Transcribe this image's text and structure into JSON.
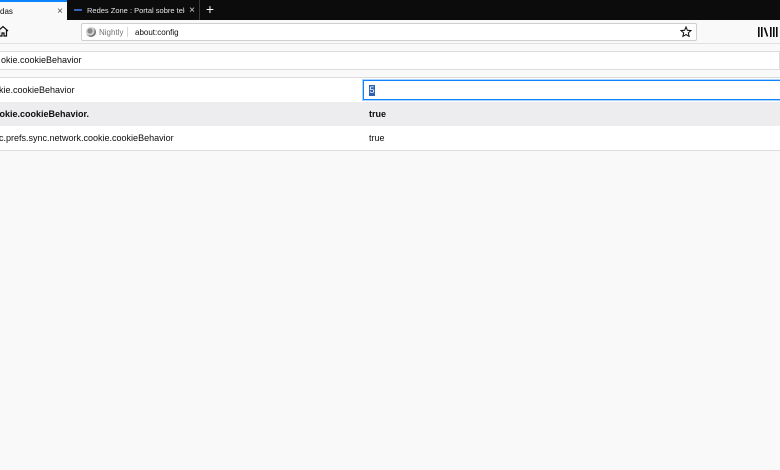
{
  "tabs": [
    {
      "title": "das",
      "active": true,
      "close": "×"
    },
    {
      "title": "Redes Zone : Portal sobre telec",
      "active": false,
      "close": "×"
    }
  ],
  "new_tab_label": "+",
  "navbar": {
    "identity_label": "Nightly",
    "url": "about:config"
  },
  "search": {
    "value": "okie.cookieBehavior"
  },
  "prefs": [
    {
      "name": "okie.cookieBehavior",
      "value": "5",
      "editing": true,
      "bold": false
    },
    {
      "name": "ookie.cookieBehavior.",
      "value": "true",
      "editing": false,
      "bold": true
    },
    {
      "name": "nc.prefs.sync.network.cookie.cookieBehavior",
      "value": "true",
      "editing": false,
      "bold": false
    }
  ],
  "colors": {
    "accent": "#0a84ff",
    "tabstrip_bg": "#0c0c0d",
    "page_bg": "#f9f9fa"
  },
  "icons": [
    "home-icon",
    "nightly-logo-icon",
    "star-icon",
    "library-icon",
    "close-icon",
    "plus-icon",
    "favicon-icon"
  ]
}
